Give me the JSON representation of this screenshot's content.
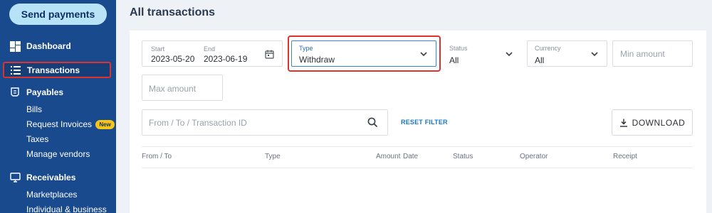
{
  "sidebar": {
    "send_payments": "Send payments",
    "dashboard": "Dashboard",
    "transactions": "Transactions",
    "payables": "Payables",
    "payables_items": [
      "Bills",
      "Request Invoices",
      "Taxes",
      "Manage vendors"
    ],
    "new_badge": "New",
    "receivables": "Receivables",
    "receivables_items": [
      "Marketplaces",
      "Individual & business"
    ]
  },
  "main": {
    "title": "All transactions",
    "filters": {
      "start_label": "Start",
      "start_value": "2023-05-20",
      "end_label": "End",
      "end_value": "2023-06-19",
      "type_label": "Type",
      "type_value": "Withdraw",
      "status_label": "Status",
      "status_value": "All",
      "currency_label": "Currency",
      "currency_value": "All",
      "min_amount_placeholder": "Min amount",
      "max_amount_placeholder": "Max amount",
      "search_placeholder": "From / To / Transaction ID",
      "reset_filter": "RESET FILTER",
      "download": "DOWNLOAD"
    },
    "table": {
      "columns": [
        "From / To",
        "Type",
        "Amount",
        "Date",
        "Status",
        "Operator",
        "Receipt"
      ]
    }
  },
  "colors": {
    "sidebar_bg": "#1a4a8e",
    "send_button_bg": "#b8e3f7",
    "accent_link": "#1a78c2",
    "highlight_red": "#e0312c",
    "new_badge": "#f5c518"
  }
}
